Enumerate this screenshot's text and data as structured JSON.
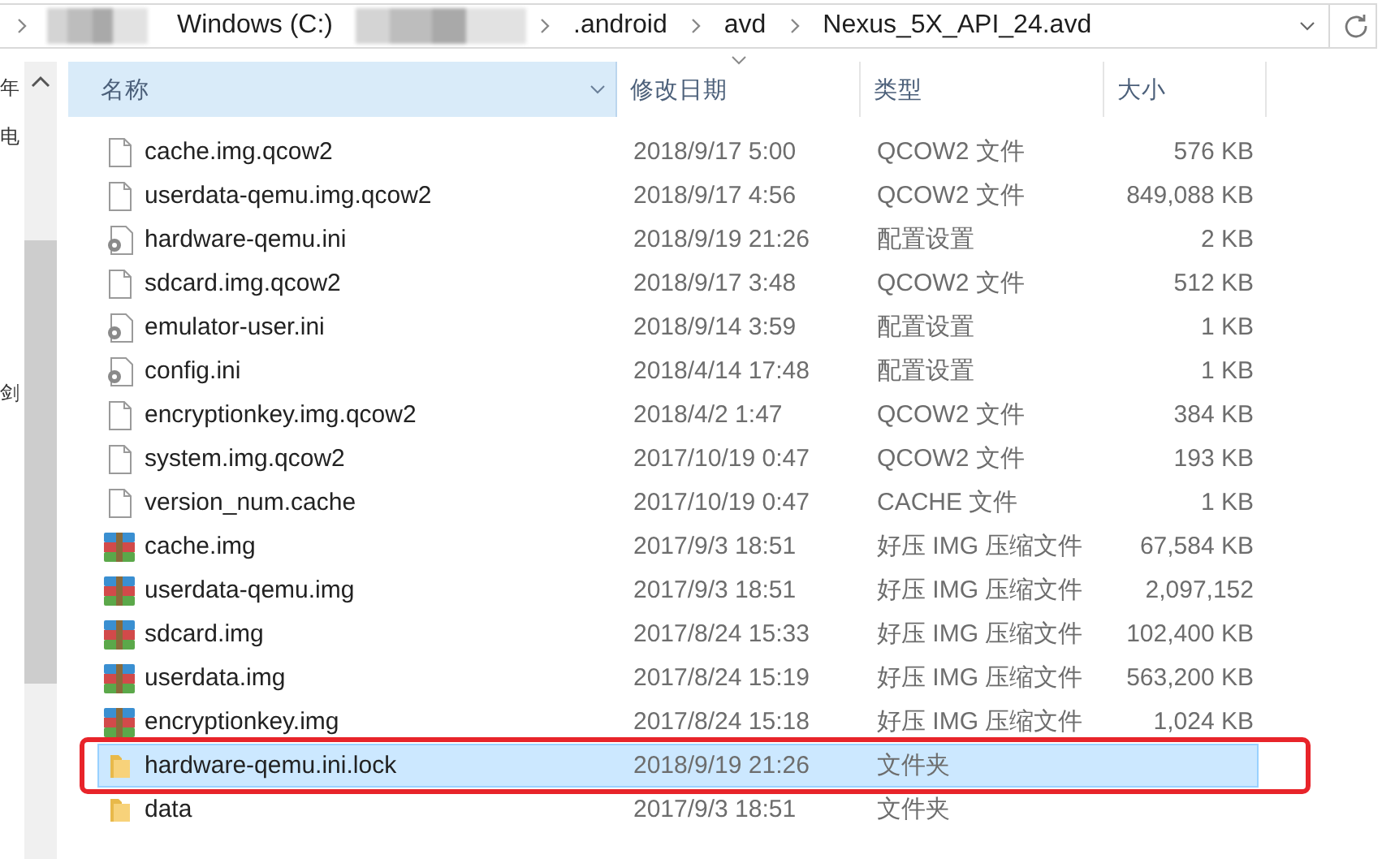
{
  "address_bar": {
    "crumbs": [
      {
        "kind": "redacted",
        "sep": true
      },
      {
        "kind": "text",
        "label": "Windows (C:)",
        "sep": false
      },
      {
        "kind": "redacted",
        "sep": false
      },
      {
        "kind": "text",
        "label": ".android",
        "sep": true
      },
      {
        "kind": "text",
        "label": "avd",
        "sep": true
      },
      {
        "kind": "text",
        "label": "Nexus_5X_API_24.avd",
        "sep": true
      }
    ]
  },
  "nav_pane": {
    "texts": [
      "年",
      "电",
      "剑"
    ]
  },
  "columns": [
    {
      "label": "名称",
      "highlighted": true,
      "sorted": false
    },
    {
      "label": "修改日期",
      "highlighted": false,
      "sorted": true
    },
    {
      "label": "类型",
      "highlighted": false,
      "sorted": false
    },
    {
      "label": "大小",
      "highlighted": false,
      "sorted": false
    }
  ],
  "rows": [
    {
      "kind": "file",
      "name": "cache.img.qcow2",
      "date": "2018/9/17 5:00",
      "type": "QCOW2 文件",
      "size": "576 KB",
      "selected": false,
      "annotated": false
    },
    {
      "kind": "file",
      "name": "userdata-qemu.img.qcow2",
      "date": "2018/9/17 4:56",
      "type": "QCOW2 文件",
      "size": "849,088 KB",
      "selected": false,
      "annotated": false
    },
    {
      "kind": "config",
      "name": "hardware-qemu.ini",
      "date": "2018/9/19 21:26",
      "type": "配置设置",
      "size": "2 KB",
      "selected": false,
      "annotated": false
    },
    {
      "kind": "file",
      "name": "sdcard.img.qcow2",
      "date": "2018/9/17 3:48",
      "type": "QCOW2 文件",
      "size": "512 KB",
      "selected": false,
      "annotated": false
    },
    {
      "kind": "config",
      "name": "emulator-user.ini",
      "date": "2018/9/14 3:59",
      "type": "配置设置",
      "size": "1 KB",
      "selected": false,
      "annotated": false
    },
    {
      "kind": "config",
      "name": "config.ini",
      "date": "2018/4/14 17:48",
      "type": "配置设置",
      "size": "1 KB",
      "selected": false,
      "annotated": false
    },
    {
      "kind": "file",
      "name": "encryptionkey.img.qcow2",
      "date": "2018/4/2 1:47",
      "type": "QCOW2 文件",
      "size": "384 KB",
      "selected": false,
      "annotated": false
    },
    {
      "kind": "file",
      "name": "system.img.qcow2",
      "date": "2017/10/19 0:47",
      "type": "QCOW2 文件",
      "size": "193 KB",
      "selected": false,
      "annotated": false
    },
    {
      "kind": "file",
      "name": "version_num.cache",
      "date": "2017/10/19 0:47",
      "type": "CACHE 文件",
      "size": "1 KB",
      "selected": false,
      "annotated": false
    },
    {
      "kind": "archive",
      "name": "cache.img",
      "date": "2017/9/3 18:51",
      "type": "好压 IMG 压缩文件",
      "size": "67,584 KB",
      "selected": false,
      "annotated": false
    },
    {
      "kind": "archive",
      "name": "userdata-qemu.img",
      "date": "2017/9/3 18:51",
      "type": "好压 IMG 压缩文件",
      "size": "2,097,152",
      "selected": false,
      "annotated": false
    },
    {
      "kind": "archive",
      "name": "sdcard.img",
      "date": "2017/8/24 15:33",
      "type": "好压 IMG 压缩文件",
      "size": "102,400 KB",
      "selected": false,
      "annotated": false
    },
    {
      "kind": "archive",
      "name": "userdata.img",
      "date": "2017/8/24 15:19",
      "type": "好压 IMG 压缩文件",
      "size": "563,200 KB",
      "selected": false,
      "annotated": false
    },
    {
      "kind": "archive",
      "name": "encryptionkey.img",
      "date": "2017/8/24 15:18",
      "type": "好压 IMG 压缩文件",
      "size": "1,024 KB",
      "selected": false,
      "annotated": false
    },
    {
      "kind": "folder",
      "name": "hardware-qemu.ini.lock",
      "date": "2018/9/19 21:26",
      "type": "文件夹",
      "size": "",
      "selected": true,
      "annotated": true
    },
    {
      "kind": "folder",
      "name": "data",
      "date": "2017/9/3 18:51",
      "type": "文件夹",
      "size": "",
      "selected": false,
      "annotated": false
    }
  ]
}
